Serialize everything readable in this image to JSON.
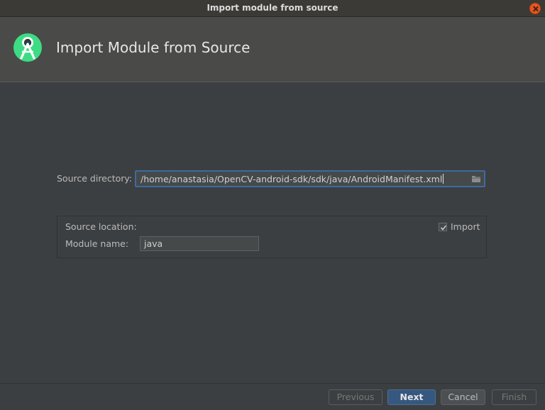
{
  "window": {
    "title": "Import module from source"
  },
  "header": {
    "title": "Import Module from Source",
    "logo_icon": "android-studio-icon"
  },
  "form": {
    "source_directory_label": "Source directory:",
    "source_directory_value": "/home/anastasia/OpenCV-android-sdk/sdk/java/AndroidManifest.xml",
    "browse_icon": "folder-icon",
    "source_location_label": "Source location:",
    "module_name_label": "Module name:",
    "module_name_value": "java",
    "import_label": "Import",
    "import_checked": true
  },
  "footer": {
    "previous_label": "Previous",
    "next_label": "Next",
    "cancel_label": "Cancel",
    "finish_label": "Finish"
  },
  "colors": {
    "accent": "#365880",
    "focus_border": "#3d6b9e",
    "logo_green": "#3ddc84",
    "close_button": "#e95420"
  }
}
